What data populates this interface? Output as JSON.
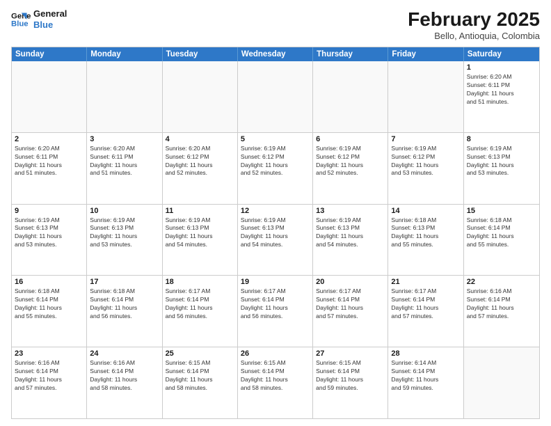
{
  "logo": {
    "line1": "General",
    "line2": "Blue"
  },
  "title": "February 2025",
  "subtitle": "Bello, Antioquia, Colombia",
  "days": [
    "Sunday",
    "Monday",
    "Tuesday",
    "Wednesday",
    "Thursday",
    "Friday",
    "Saturday"
  ],
  "weeks": [
    [
      {
        "date": "",
        "info": ""
      },
      {
        "date": "",
        "info": ""
      },
      {
        "date": "",
        "info": ""
      },
      {
        "date": "",
        "info": ""
      },
      {
        "date": "",
        "info": ""
      },
      {
        "date": "",
        "info": ""
      },
      {
        "date": "1",
        "info": "Sunrise: 6:20 AM\nSunset: 6:11 PM\nDaylight: 11 hours\nand 51 minutes."
      }
    ],
    [
      {
        "date": "2",
        "info": "Sunrise: 6:20 AM\nSunset: 6:11 PM\nDaylight: 11 hours\nand 51 minutes."
      },
      {
        "date": "3",
        "info": "Sunrise: 6:20 AM\nSunset: 6:11 PM\nDaylight: 11 hours\nand 51 minutes."
      },
      {
        "date": "4",
        "info": "Sunrise: 6:20 AM\nSunset: 6:12 PM\nDaylight: 11 hours\nand 52 minutes."
      },
      {
        "date": "5",
        "info": "Sunrise: 6:19 AM\nSunset: 6:12 PM\nDaylight: 11 hours\nand 52 minutes."
      },
      {
        "date": "6",
        "info": "Sunrise: 6:19 AM\nSunset: 6:12 PM\nDaylight: 11 hours\nand 52 minutes."
      },
      {
        "date": "7",
        "info": "Sunrise: 6:19 AM\nSunset: 6:12 PM\nDaylight: 11 hours\nand 53 minutes."
      },
      {
        "date": "8",
        "info": "Sunrise: 6:19 AM\nSunset: 6:13 PM\nDaylight: 11 hours\nand 53 minutes."
      }
    ],
    [
      {
        "date": "9",
        "info": "Sunrise: 6:19 AM\nSunset: 6:13 PM\nDaylight: 11 hours\nand 53 minutes."
      },
      {
        "date": "10",
        "info": "Sunrise: 6:19 AM\nSunset: 6:13 PM\nDaylight: 11 hours\nand 53 minutes."
      },
      {
        "date": "11",
        "info": "Sunrise: 6:19 AM\nSunset: 6:13 PM\nDaylight: 11 hours\nand 54 minutes."
      },
      {
        "date": "12",
        "info": "Sunrise: 6:19 AM\nSunset: 6:13 PM\nDaylight: 11 hours\nand 54 minutes."
      },
      {
        "date": "13",
        "info": "Sunrise: 6:19 AM\nSunset: 6:13 PM\nDaylight: 11 hours\nand 54 minutes."
      },
      {
        "date": "14",
        "info": "Sunrise: 6:18 AM\nSunset: 6:13 PM\nDaylight: 11 hours\nand 55 minutes."
      },
      {
        "date": "15",
        "info": "Sunrise: 6:18 AM\nSunset: 6:14 PM\nDaylight: 11 hours\nand 55 minutes."
      }
    ],
    [
      {
        "date": "16",
        "info": "Sunrise: 6:18 AM\nSunset: 6:14 PM\nDaylight: 11 hours\nand 55 minutes."
      },
      {
        "date": "17",
        "info": "Sunrise: 6:18 AM\nSunset: 6:14 PM\nDaylight: 11 hours\nand 56 minutes."
      },
      {
        "date": "18",
        "info": "Sunrise: 6:17 AM\nSunset: 6:14 PM\nDaylight: 11 hours\nand 56 minutes."
      },
      {
        "date": "19",
        "info": "Sunrise: 6:17 AM\nSunset: 6:14 PM\nDaylight: 11 hours\nand 56 minutes."
      },
      {
        "date": "20",
        "info": "Sunrise: 6:17 AM\nSunset: 6:14 PM\nDaylight: 11 hours\nand 57 minutes."
      },
      {
        "date": "21",
        "info": "Sunrise: 6:17 AM\nSunset: 6:14 PM\nDaylight: 11 hours\nand 57 minutes."
      },
      {
        "date": "22",
        "info": "Sunrise: 6:16 AM\nSunset: 6:14 PM\nDaylight: 11 hours\nand 57 minutes."
      }
    ],
    [
      {
        "date": "23",
        "info": "Sunrise: 6:16 AM\nSunset: 6:14 PM\nDaylight: 11 hours\nand 57 minutes."
      },
      {
        "date": "24",
        "info": "Sunrise: 6:16 AM\nSunset: 6:14 PM\nDaylight: 11 hours\nand 58 minutes."
      },
      {
        "date": "25",
        "info": "Sunrise: 6:15 AM\nSunset: 6:14 PM\nDaylight: 11 hours\nand 58 minutes."
      },
      {
        "date": "26",
        "info": "Sunrise: 6:15 AM\nSunset: 6:14 PM\nDaylight: 11 hours\nand 58 minutes."
      },
      {
        "date": "27",
        "info": "Sunrise: 6:15 AM\nSunset: 6:14 PM\nDaylight: 11 hours\nand 59 minutes."
      },
      {
        "date": "28",
        "info": "Sunrise: 6:14 AM\nSunset: 6:14 PM\nDaylight: 11 hours\nand 59 minutes."
      },
      {
        "date": "",
        "info": ""
      }
    ]
  ]
}
